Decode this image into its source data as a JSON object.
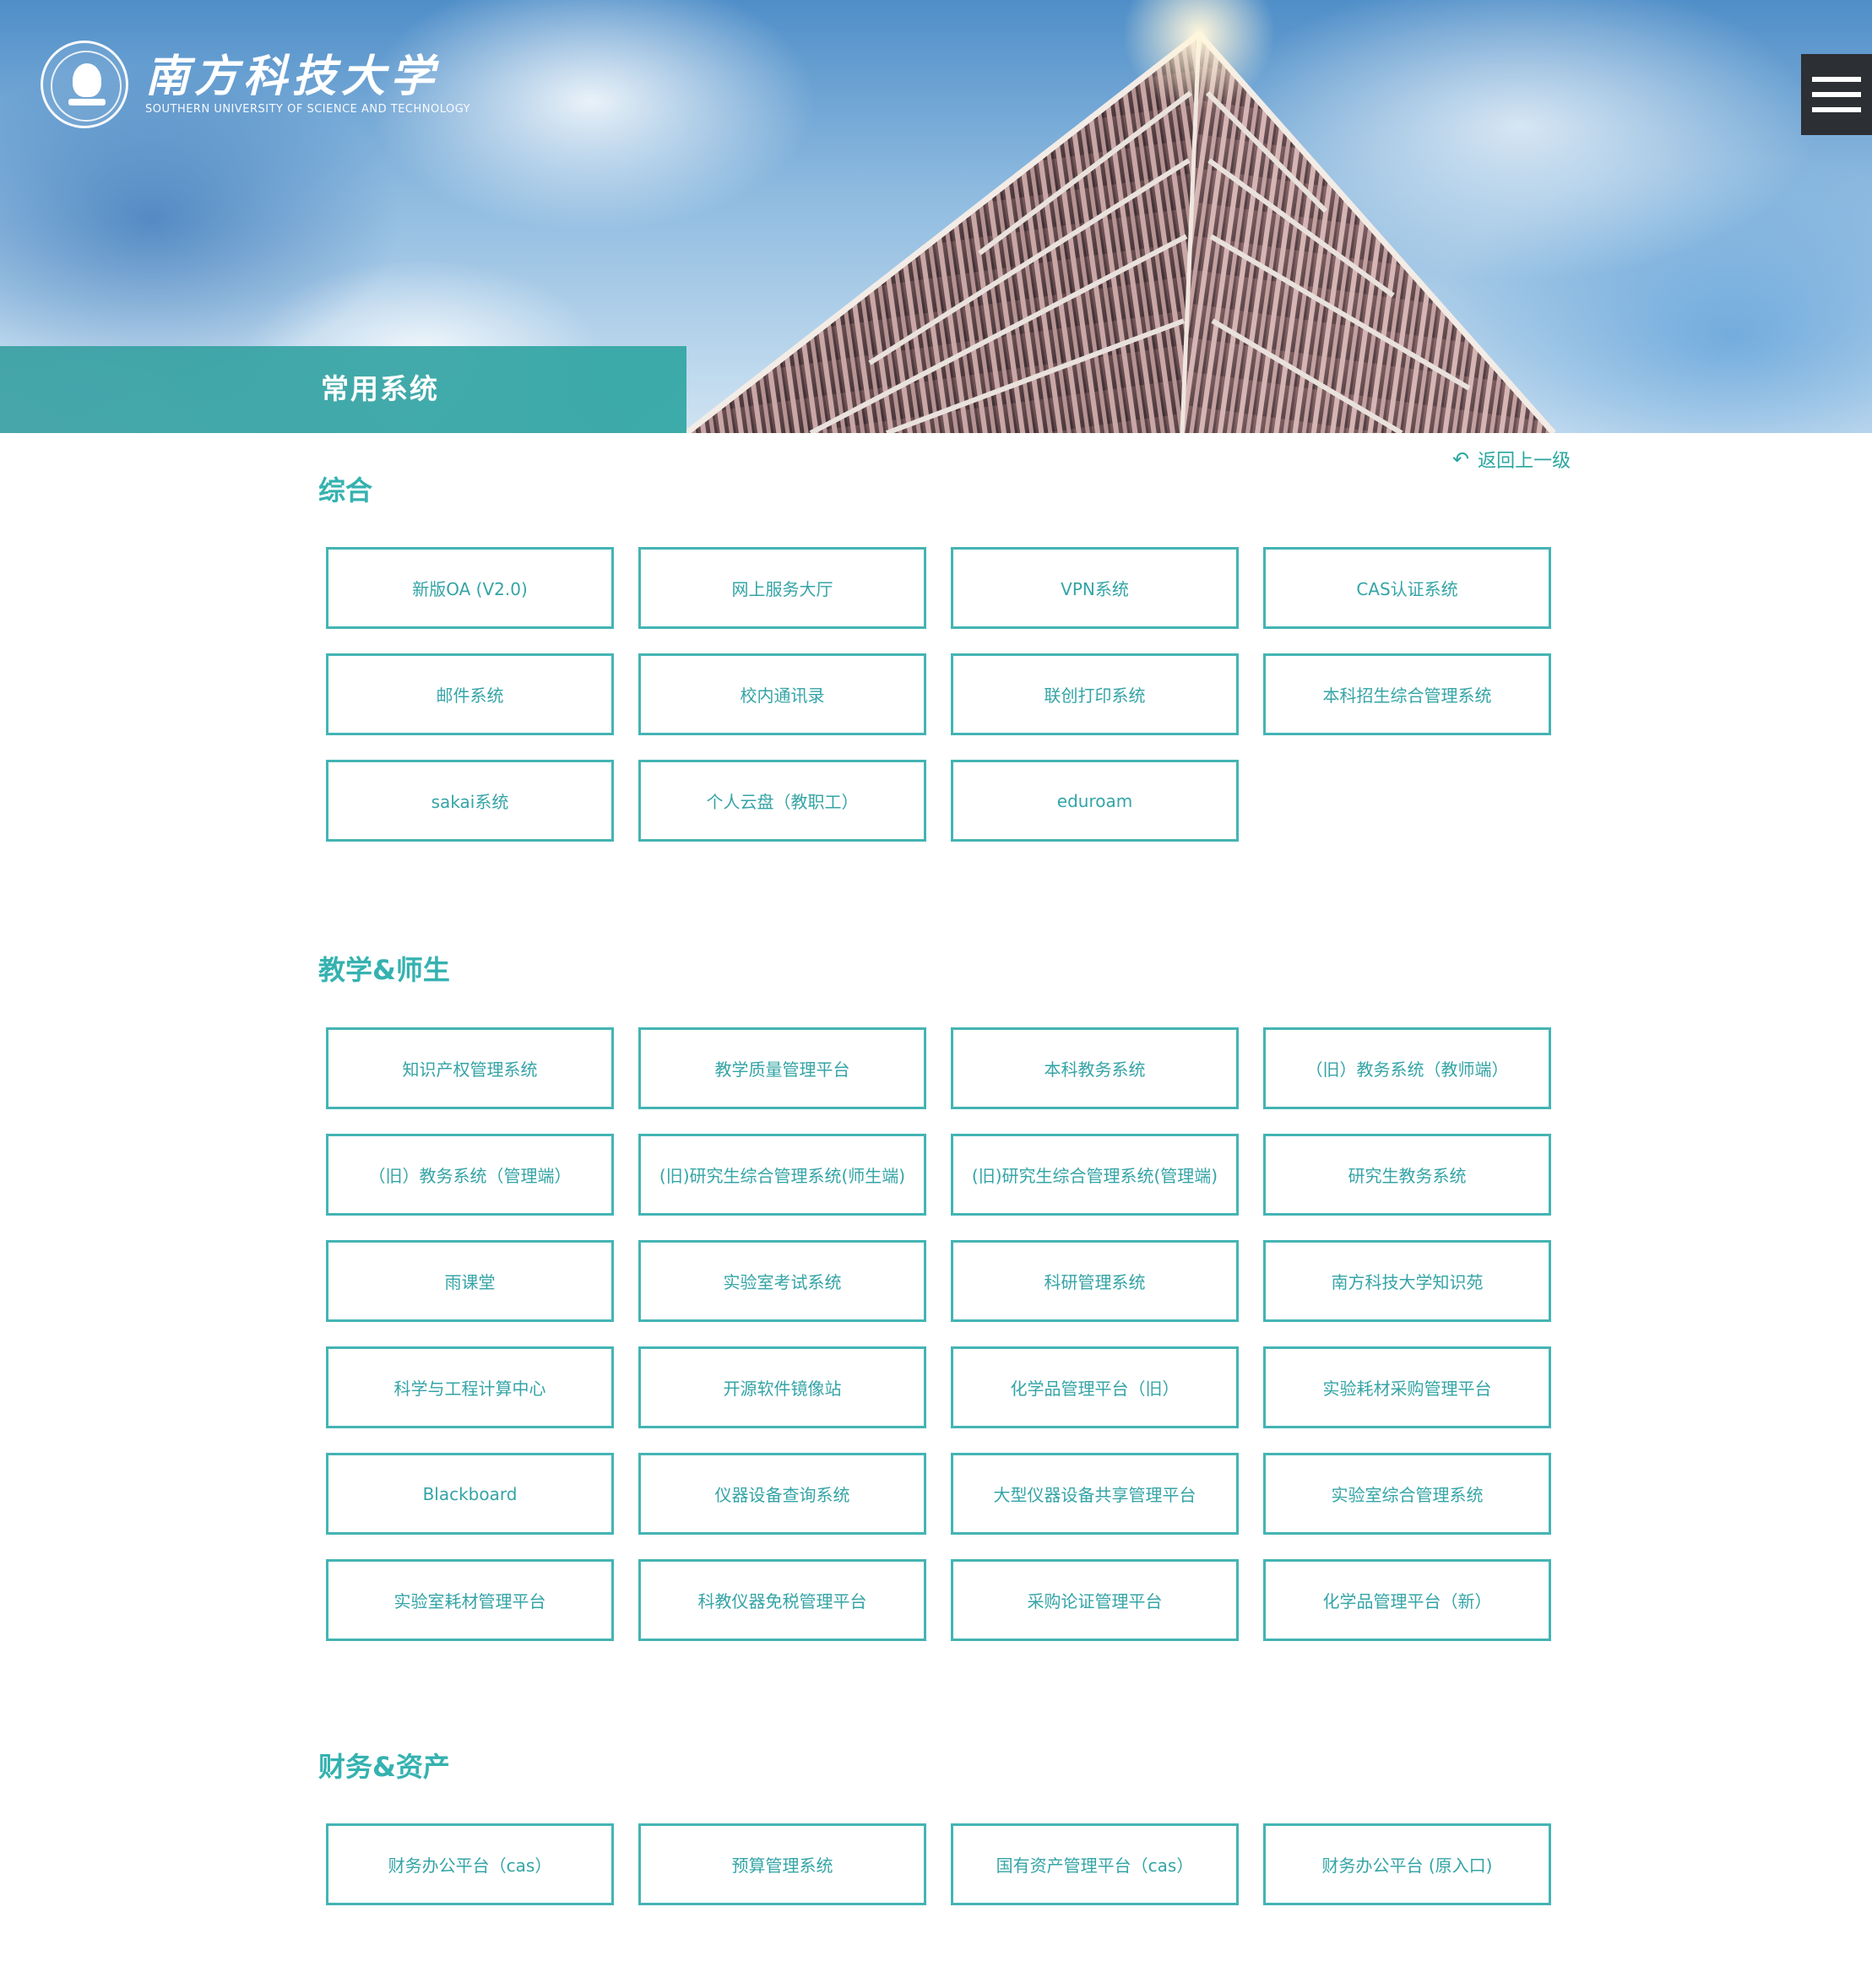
{
  "header": {
    "logo_cn": "南方科技大学",
    "logo_en": "SOUTHERN UNIVERSITY OF SCIENCE AND TECHNOLOGY",
    "menu_icon": "hamburger-menu-icon",
    "page_title": "常用系统"
  },
  "back_link": {
    "label": "返回上一级",
    "icon": "return-arrow-icon"
  },
  "colors": {
    "accent": "#35b2b0",
    "border": "#44b4b4",
    "menu_bg": "#2c2f33"
  },
  "sections": [
    {
      "title": "综合",
      "items": [
        "新版OA (V2.0)",
        "网上服务大厅",
        "VPN系统",
        "CAS认证系统",
        "邮件系统",
        "校内通讯录",
        "联创打印系统",
        "本科招生综合管理系统",
        "sakai系统",
        "个人云盘（教职工）",
        "eduroam"
      ]
    },
    {
      "title": "教学&师生",
      "items": [
        "知识产权管理系统",
        "教学质量管理平台",
        "本科教务系统",
        "（旧）教务系统（教师端）",
        "（旧）教务系统（管理端）",
        "(旧)研究生综合管理系统(师生端)",
        "(旧)研究生综合管理系统(管理端)",
        "研究生教务系统",
        "雨课堂",
        "实验室考试系统",
        "科研管理系统",
        "南方科技大学知识苑",
        "科学与工程计算中心",
        "开源软件镜像站",
        "化学品管理平台（旧）",
        "实验耗材采购管理平台",
        "Blackboard",
        "仪器设备查询系统",
        "大型仪器设备共享管理平台",
        "实验室综合管理系统",
        "实验室耗材管理平台",
        "科教仪器免税管理平台",
        "采购论证管理平台",
        "化学品管理平台（新）"
      ]
    },
    {
      "title": "财务&资产",
      "items": [
        "财务办公平台（cas）",
        "预算管理系统",
        "国有资产管理平台（cas）",
        "财务办公平台 (原入口)"
      ]
    }
  ]
}
